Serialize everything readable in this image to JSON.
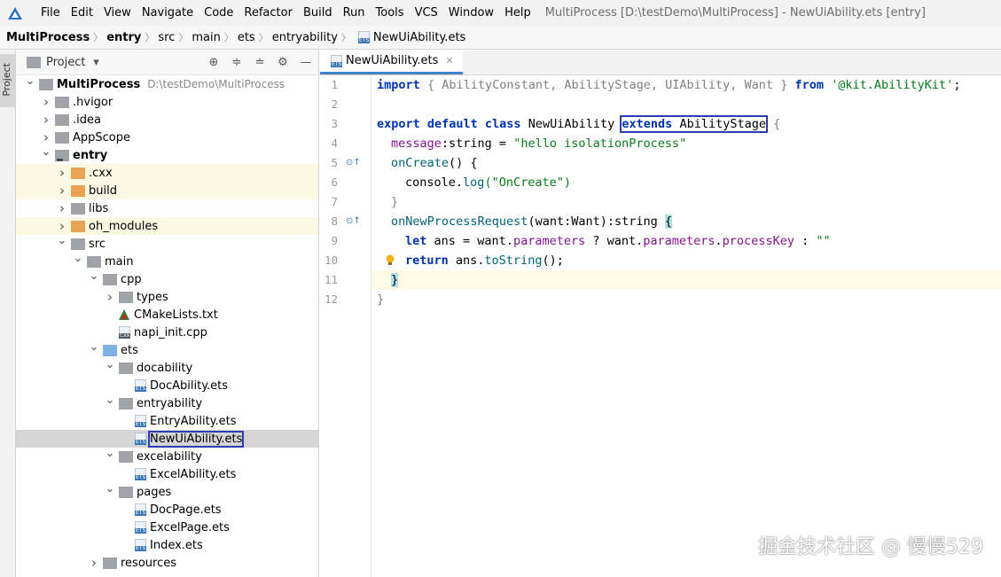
{
  "menubar": {
    "items": [
      "File",
      "Edit",
      "View",
      "Navigate",
      "Code",
      "Refactor",
      "Build",
      "Run",
      "Tools",
      "VCS",
      "Window",
      "Help"
    ],
    "window_title": "MultiProcess [D:\\testDemo\\MultiProcess] - NewUiAbility.ets [entry]"
  },
  "breadcrumb": [
    "MultiProcess",
    "entry",
    "src",
    "main",
    "ets",
    "entryability",
    "NewUiAbility.ets"
  ],
  "leftstrip": {
    "label": "Project"
  },
  "project_panel": {
    "title": "Project",
    "tree": [
      {
        "label": "MultiProcess",
        "path": "D:\\testDemo\\MultiProcess",
        "depth": 0,
        "icon": "folder-grey",
        "expanded": true,
        "bold": true
      },
      {
        "label": ".hvigor",
        "depth": 1,
        "icon": "folder-grey",
        "expanded": false
      },
      {
        "label": ".idea",
        "depth": 1,
        "icon": "folder-grey",
        "expanded": false
      },
      {
        "label": "AppScope",
        "depth": 1,
        "icon": "folder-grey",
        "expanded": false
      },
      {
        "label": "entry",
        "depth": 1,
        "icon": "folder-grey-module",
        "expanded": true,
        "bold": true
      },
      {
        "label": ".cxx",
        "depth": 2,
        "icon": "folder-orange",
        "expanded": false,
        "highlight": true
      },
      {
        "label": "build",
        "depth": 2,
        "icon": "folder-orange",
        "expanded": false,
        "highlight": true
      },
      {
        "label": "libs",
        "depth": 2,
        "icon": "folder-grey",
        "expanded": false
      },
      {
        "label": "oh_modules",
        "depth": 2,
        "icon": "folder-orange",
        "expanded": false,
        "highlight": true
      },
      {
        "label": "src",
        "depth": 2,
        "icon": "folder-grey",
        "expanded": true
      },
      {
        "label": "main",
        "depth": 3,
        "icon": "folder-grey",
        "expanded": true
      },
      {
        "label": "cpp",
        "depth": 4,
        "icon": "folder-grey",
        "expanded": true
      },
      {
        "label": "types",
        "depth": 5,
        "icon": "folder-grey",
        "expanded": false
      },
      {
        "label": "CMakeLists.txt",
        "depth": 5,
        "icon": "cmake-file",
        "leaf": true
      },
      {
        "label": "napi_init.cpp",
        "depth": 5,
        "icon": "cxx-file",
        "leaf": true
      },
      {
        "label": "ets",
        "depth": 4,
        "icon": "folder-blue",
        "expanded": true
      },
      {
        "label": "docability",
        "depth": 5,
        "icon": "folder-grey",
        "expanded": true
      },
      {
        "label": "DocAbility.ets",
        "depth": 6,
        "icon": "ets-file",
        "leaf": true
      },
      {
        "label": "entryability",
        "depth": 5,
        "icon": "folder-grey",
        "expanded": true
      },
      {
        "label": "EntryAbility.ets",
        "depth": 6,
        "icon": "ets-file",
        "leaf": true
      },
      {
        "label": "NewUiAbility.ets",
        "depth": 6,
        "icon": "ets-file",
        "leaf": true,
        "selected": true
      },
      {
        "label": "excelability",
        "depth": 5,
        "icon": "folder-grey",
        "expanded": true
      },
      {
        "label": "ExcelAbility.ets",
        "depth": 6,
        "icon": "ets-file",
        "leaf": true
      },
      {
        "label": "pages",
        "depth": 5,
        "icon": "folder-grey",
        "expanded": true
      },
      {
        "label": "DocPage.ets",
        "depth": 6,
        "icon": "ets-file",
        "leaf": true
      },
      {
        "label": "ExcelPage.ets",
        "depth": 6,
        "icon": "ets-file",
        "leaf": true
      },
      {
        "label": "Index.ets",
        "depth": 6,
        "icon": "ets-file",
        "leaf": true
      },
      {
        "label": "resources",
        "depth": 4,
        "icon": "folder-grey",
        "expanded": false
      }
    ]
  },
  "editor": {
    "tab_label": "NewUiAbility.ets",
    "current_line": 11,
    "lines": [
      {
        "n": "1"
      },
      {
        "n": "2"
      },
      {
        "n": "3"
      },
      {
        "n": "4"
      },
      {
        "n": "5"
      },
      {
        "n": "6"
      },
      {
        "n": "7"
      },
      {
        "n": "8"
      },
      {
        "n": "9"
      },
      {
        "n": "10"
      },
      {
        "n": "11"
      },
      {
        "n": "12"
      }
    ],
    "code": {
      "l1": {
        "import": "import",
        "ob": "{",
        "names": " AbilityConstant, AbilityStage, UIAbility, Want ",
        "cb": "}",
        "from": "from",
        "mod": "'@kit.AbilityKit'",
        "semi": ";"
      },
      "l3": {
        "export": "export default class",
        "name": "NewUiAbility",
        "extends": "extends",
        "base": "AbilityStage",
        "ob": "{"
      },
      "l4": {
        "prop": "message",
        "type": ":string = ",
        "val": "\"hello isolationProcess\""
      },
      "l5": {
        "fn": "onCreate",
        "rest": "() {"
      },
      "l6": {
        "obj": "console",
        "dot": ".",
        "fn": "log",
        "args": "(\"OnCreate\")"
      },
      "l7": {
        "cb": "}"
      },
      "l8": {
        "fn": "onNewProcessRequest",
        "params": "(want:Want):string ",
        "ob": "{"
      },
      "l9": {
        "let": "let",
        "v": " ans = want.",
        "p1": "parameters",
        "q": " ? want.",
        "p2": "parameters",
        "d": ".",
        "p3": "processKey",
        "tail": " : ",
        "empty": "\"\""
      },
      "l10": {
        "ret": "return",
        "rest": " ans.",
        "fn": "toString",
        "end": "();"
      },
      "l11": {
        "cb": "}"
      },
      "l12": {
        "cb": "}"
      }
    }
  },
  "watermark": "掘金技术社区 @ 慢慢529"
}
